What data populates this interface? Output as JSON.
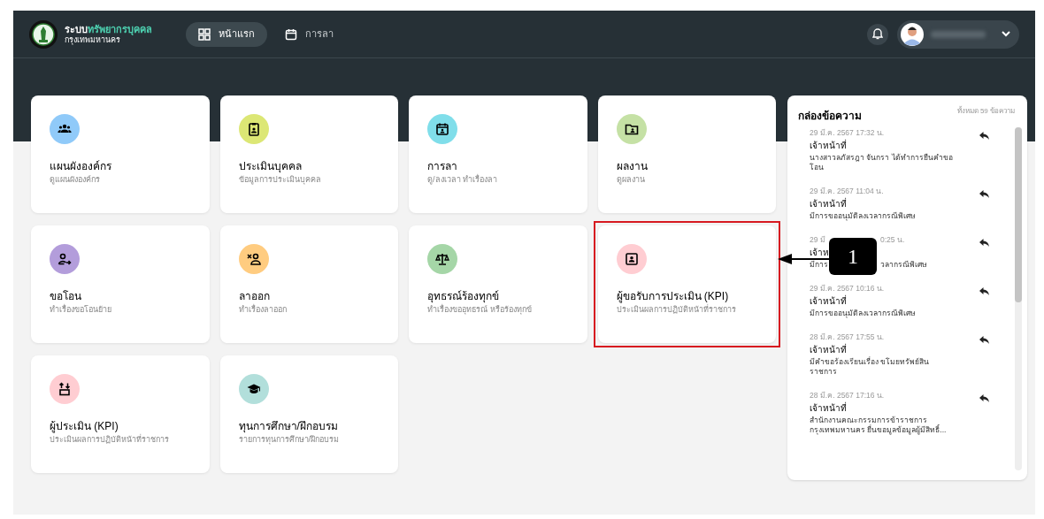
{
  "header": {
    "system_title_prefix": "ระบบ",
    "system_title_highlight": "ทรัพยากรบุคคล",
    "system_subtitle": "กรุงเทพมหานคร",
    "nav": [
      {
        "label": "หน้าแรก",
        "kind": "grid",
        "selected": true
      },
      {
        "label": "การลา",
        "kind": "calendar",
        "selected": false
      }
    ]
  },
  "cards": [
    {
      "title": "แผนผังองค์กร",
      "subtitle": "ดูแผนผังองค์กร",
      "kind": "people",
      "color": "#90caf9",
      "highlighted": false
    },
    {
      "title": "ประเมินบุคคล",
      "subtitle": "ข้อมูลการประเมินบุคคล",
      "kind": "badge",
      "color": "#dce775",
      "highlighted": false
    },
    {
      "title": "การลา",
      "subtitle": "ดู/ลงเวลา ทำเรื่องลา",
      "kind": "calendar",
      "color": "#80deea",
      "highlighted": false
    },
    {
      "title": "ผลงาน",
      "subtitle": "ดูผลงาน",
      "kind": "folder",
      "color": "#c5e1a5",
      "highlighted": false
    },
    {
      "title": "ขอโอน",
      "subtitle": "ทำเรื่องขอโอนย้าย",
      "kind": "transfer",
      "color": "#b39ddb",
      "highlighted": false
    },
    {
      "title": "ลาออก",
      "subtitle": "ทำเรื่องลาออก",
      "kind": "resign",
      "color": "#ffcc80",
      "highlighted": false
    },
    {
      "title": "อุทธรณ์ร้องทุกข์",
      "subtitle": "ทำเรื่องขออุทธรณ์ หรือร้องทุกข์",
      "kind": "scale",
      "color": "#a5d6a7",
      "highlighted": false
    },
    {
      "title": "ผู้ขอรับการประเมิน (KPI)",
      "subtitle": "ประเมินผลการปฏิบัติหน้าที่ราชการ",
      "kind": "portrait",
      "color": "#ffcdd2",
      "highlighted": true
    },
    {
      "title": "ผู้ประเมิน (KPI)",
      "subtitle": "ประเมินผลการปฏิบัติหน้าที่ราชการ",
      "kind": "swap",
      "color": "#ffcdd2",
      "highlighted": false
    },
    {
      "title": "ทุนการศึกษา/ฝึกอบรม",
      "subtitle": "รายการทุนการศึกษา/ฝึกอบรม",
      "kind": "cap",
      "color": "#b2dfdb",
      "highlighted": false
    }
  ],
  "inbox": {
    "title": "กล่องข้อความ",
    "total": "ทั้งหมด 59 ข้อความ",
    "messages": [
      {
        "kind": "full",
        "time": "29 มี.ค. 2567 17:32 น.",
        "sender": "เจ้าหน้าที่",
        "body": "นางสาวลภัสรฎา จันกรา ได้ทำการยืนคำขอโอน"
      },
      {
        "kind": "full",
        "time": "29 มี.ค. 2567 11:04 น.",
        "sender": "เจ้าหน้าที่",
        "body": "มีการขออนุมัติลงเวลากรณีพิเศษ"
      },
      {
        "kind": "covered",
        "time_start": "29 มี",
        "time_end": "0:25 น.",
        "sender_start": "เจ้าห",
        "body_start": "มีการ",
        "body_end": "วลากรณีพิเศษ"
      },
      {
        "kind": "full",
        "time": "29 มี.ค. 2567 10:16 น.",
        "sender": "เจ้าหน้าที่",
        "body": "มีการขออนุมัติลงเวลากรณีพิเศษ"
      },
      {
        "kind": "full",
        "time": "28 มี.ค. 2567 17:55 น.",
        "sender": "เจ้าหน้าที่",
        "body": "มีคำขอร้องเรียนเรื่อง ขโมยทรัพย์สินราชการ"
      },
      {
        "kind": "full",
        "time": "28 มี.ค. 2567 17:16 น.",
        "sender": "เจ้าหน้าที่",
        "body": "สำนักงานคณะกรรมการข้าราชการกรุงเทพมหานคร ยื่นขอมูลข้อมูลผู้มีสิทธิ์..."
      }
    ]
  },
  "callout": {
    "label": "1"
  }
}
